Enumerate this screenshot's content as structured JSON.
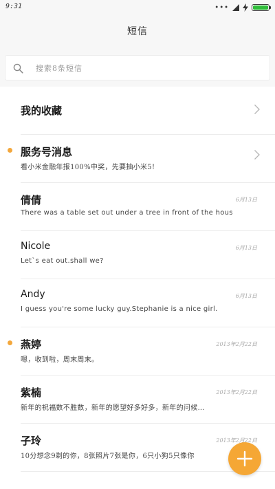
{
  "status_bar": {
    "time": "9:31",
    "dots": "•••",
    "battery_level": 1.0,
    "battery_color": "#2fbd3a"
  },
  "header": {
    "title": "短信"
  },
  "search": {
    "placeholder": "搜索8条短信"
  },
  "accent_color": "#f5a735",
  "conversations": [
    {
      "name": "我的收藏",
      "preview": "",
      "date": "",
      "unread": false,
      "chevron": true
    },
    {
      "name": "服务号消息",
      "preview": "看小米金融年报100%中奖，先要抽小米5!",
      "date": "",
      "unread": true,
      "chevron": true
    },
    {
      "name": "倩倩",
      "preview": "There was a table set out under a tree in front of the hous",
      "date": "6月13日",
      "unread": false,
      "chevron": false
    },
    {
      "name": "Nicole",
      "preview": "Let`s eat out.shall we?",
      "date": "6月13日",
      "unread": false,
      "chevron": false
    },
    {
      "name": "Andy",
      "preview": "I guess you're some lucky guy.Stephanie is a nice girl.",
      "date": "6月13日",
      "unread": false,
      "chevron": false
    },
    {
      "name": "燕婷",
      "preview": "嗯，收到啦，周末周末。",
      "date": "2013年2月22日",
      "unread": true,
      "chevron": false
    },
    {
      "name": "紫楠",
      "preview": "新年的祝福数不胜数，新年的愿望好多好多，新年的问候…",
      "date": "2013年2月22日",
      "unread": false,
      "chevron": false
    },
    {
      "name": "子玲",
      "preview": "10分想念9剃的你，8张照片7张是你，6只小狗5只像你",
      "date": "2013年2月22日",
      "unread": false,
      "chevron": false
    }
  ],
  "fab": {
    "icon": "plus-icon"
  }
}
